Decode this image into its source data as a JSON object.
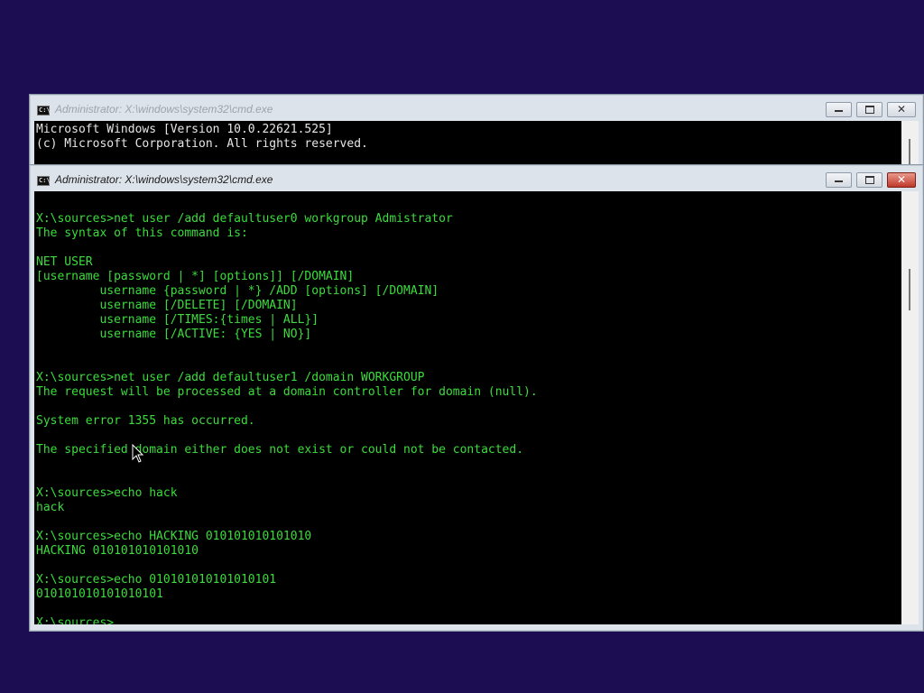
{
  "colors": {
    "desktop": "#1c0c52",
    "console_bg": "#000000",
    "back_text": "#e6e6e6",
    "front_text": "#3cdc3c"
  },
  "back_window": {
    "icon_text": "C:\\",
    "title": "Administrator: X:\\windows\\system32\\cmd.exe",
    "lines": [
      "Microsoft Windows [Version 10.0.22621.525]",
      "(c) Microsoft Corporation. All rights reserved."
    ]
  },
  "front_window": {
    "icon_text": "C:\\",
    "title": "Administrator: X:\\windows\\system32\\cmd.exe",
    "lines": [
      "",
      "X:\\sources>net user /add defaultuser0 workgroup Admistrator",
      "The syntax of this command is:",
      "",
      "NET USER",
      "[username [password | *] [options]] [/DOMAIN]",
      "         username {password | *} /ADD [options] [/DOMAIN]",
      "         username [/DELETE] [/DOMAIN]",
      "         username [/TIMES:{times | ALL}]",
      "         username [/ACTIVE: {YES | NO}]",
      "",
      "",
      "X:\\sources>net user /add defaultuser1 /domain WORKGROUP",
      "The request will be processed at a domain controller for domain (null).",
      "",
      "System error 1355 has occurred.",
      "",
      "The specified domain either does not exist or could not be contacted.",
      "",
      "",
      "X:\\sources>echo hack",
      "hack",
      "",
      "X:\\sources>echo HACKING 010101010101010",
      "HACKING 010101010101010",
      "",
      "X:\\sources>echo 010101010101010101",
      "010101010101010101",
      "",
      "X:\\sources>"
    ]
  },
  "icons": {
    "app": "cmd-icon",
    "minimize": "minimize-icon",
    "maximize": "maximize-icon",
    "close": "close-icon",
    "pointer": "mouse-pointer-icon"
  }
}
